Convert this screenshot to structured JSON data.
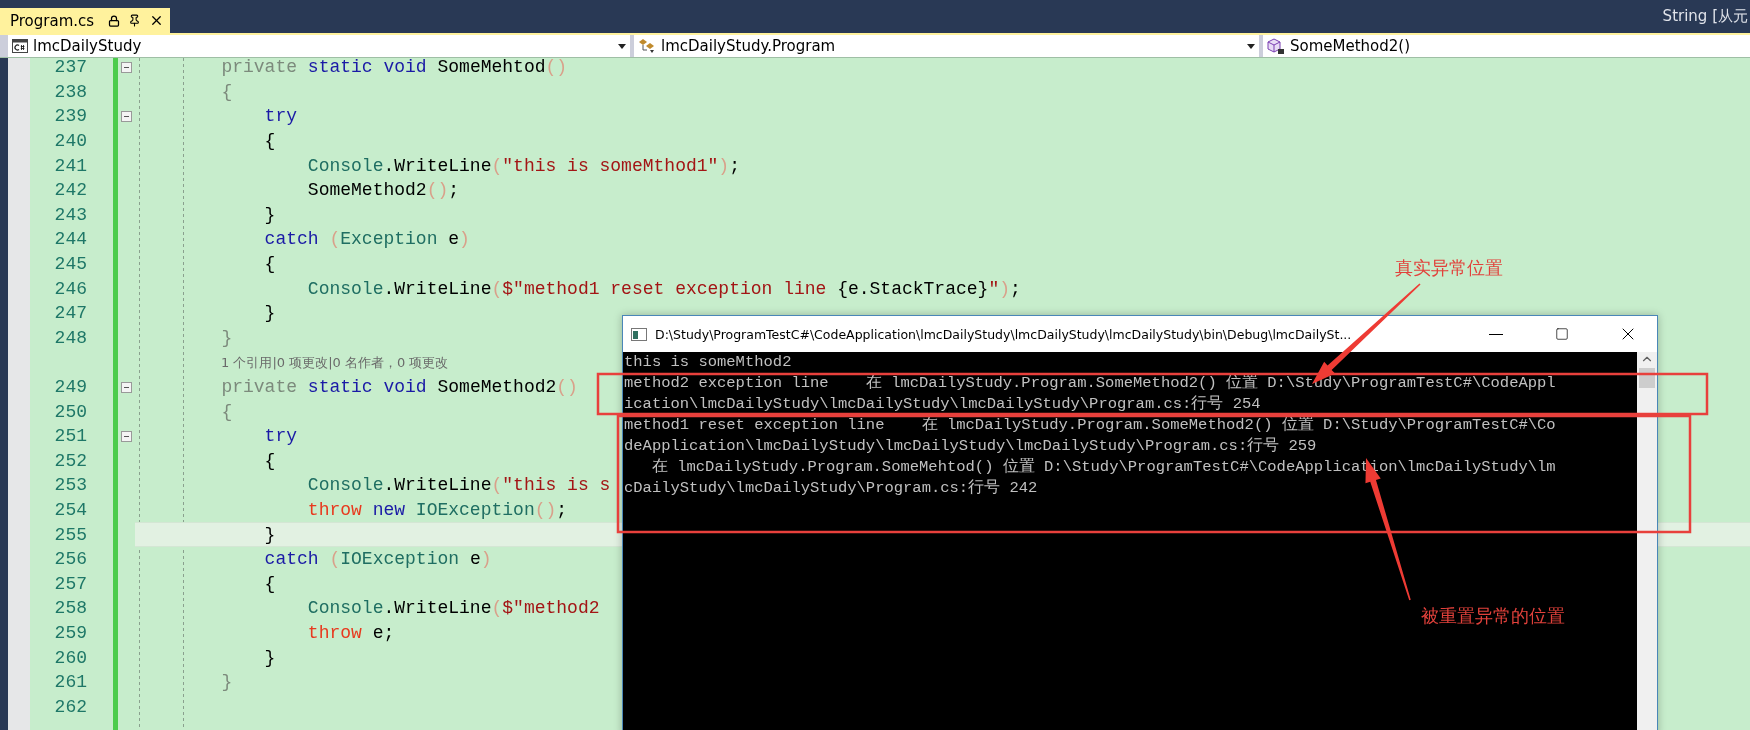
{
  "title_bar": {
    "tab": {
      "label": "Program.cs",
      "selected": true
    },
    "right_text": "String [从元"
  },
  "nav_bar": {
    "dropdowns": [
      {
        "kind": "project",
        "label": "lmcDailyStudy"
      },
      {
        "kind": "class",
        "label": "lmcDailyStudy.Program"
      },
      {
        "kind": "method",
        "label": "SomeMethod2()"
      }
    ]
  },
  "editor": {
    "lines": [
      {
        "kind": "code",
        "number": "237",
        "collapsible": true,
        "current": false,
        "tokens": [
          {
            "text": "        private",
            "kind": "faded"
          },
          {
            "text": " static",
            "kind": "keyword"
          },
          {
            "text": " void",
            "kind": "keyword"
          },
          {
            "text": " SomeMehtod",
            "kind": "plain"
          },
          {
            "text": "()",
            "kind": "paren"
          }
        ]
      },
      {
        "kind": "code",
        "number": "238",
        "collapsible": false,
        "current": false,
        "tokens": [
          {
            "text": "        {",
            "kind": "faded"
          }
        ]
      },
      {
        "kind": "code",
        "number": "239",
        "collapsible": true,
        "current": false,
        "tokens": [
          {
            "text": "            try",
            "kind": "keyword"
          }
        ]
      },
      {
        "kind": "code",
        "number": "240",
        "collapsible": false,
        "current": false,
        "tokens": [
          {
            "text": "            {",
            "kind": "plain"
          }
        ]
      },
      {
        "kind": "code",
        "number": "241",
        "collapsible": false,
        "current": false,
        "tokens": [
          {
            "text": "                Console",
            "kind": "type"
          },
          {
            "text": ".WriteLine",
            "kind": "plain"
          },
          {
            "text": "(",
            "kind": "paren"
          },
          {
            "text": "\"this is someMthod1\"",
            "kind": "string"
          },
          {
            "text": ")",
            "kind": "paren"
          },
          {
            "text": ";",
            "kind": "plain"
          }
        ]
      },
      {
        "kind": "code",
        "number": "242",
        "collapsible": false,
        "current": false,
        "tokens": [
          {
            "text": "                SomeMethod2",
            "kind": "plain"
          },
          {
            "text": "()",
            "kind": "paren"
          },
          {
            "text": ";",
            "kind": "plain"
          }
        ]
      },
      {
        "kind": "code",
        "number": "243",
        "collapsible": false,
        "current": false,
        "tokens": [
          {
            "text": "            }",
            "kind": "plain"
          }
        ]
      },
      {
        "kind": "code",
        "number": "244",
        "collapsible": false,
        "current": false,
        "tokens": [
          {
            "text": "            catch",
            "kind": "keyword"
          },
          {
            "text": " (",
            "kind": "paren"
          },
          {
            "text": "Exception",
            "kind": "type"
          },
          {
            "text": " e",
            "kind": "plain"
          },
          {
            "text": ")",
            "kind": "paren"
          }
        ]
      },
      {
        "kind": "code",
        "number": "245",
        "collapsible": false,
        "current": false,
        "tokens": [
          {
            "text": "            {",
            "kind": "plain"
          }
        ]
      },
      {
        "kind": "code",
        "number": "246",
        "collapsible": false,
        "current": false,
        "tokens": [
          {
            "text": "                Console",
            "kind": "type"
          },
          {
            "text": ".WriteLine",
            "kind": "plain"
          },
          {
            "text": "(",
            "kind": "paren"
          },
          {
            "text": "$\"method1 reset exception line ",
            "kind": "string"
          },
          {
            "text": "{e.StackTrace}",
            "kind": "plain"
          },
          {
            "text": "\"",
            "kind": "string"
          },
          {
            "text": ")",
            "kind": "paren"
          },
          {
            "text": ";",
            "kind": "plain"
          }
        ]
      },
      {
        "kind": "code",
        "number": "247",
        "collapsible": false,
        "current": false,
        "tokens": [
          {
            "text": "            }",
            "kind": "plain"
          }
        ]
      },
      {
        "kind": "code",
        "number": "248",
        "collapsible": false,
        "current": false,
        "tokens": [
          {
            "text": "        }",
            "kind": "faded"
          }
        ]
      },
      {
        "kind": "codelens",
        "text": "1 个引用|0 项更改|0 名作者，0 项更改"
      },
      {
        "kind": "code",
        "number": "249",
        "collapsible": true,
        "current": false,
        "tokens": [
          {
            "text": "        private",
            "kind": "faded"
          },
          {
            "text": " static",
            "kind": "keyword"
          },
          {
            "text": " void",
            "kind": "keyword"
          },
          {
            "text": " SomeMethod2",
            "kind": "plain"
          },
          {
            "text": "()",
            "kind": "paren"
          }
        ]
      },
      {
        "kind": "code",
        "number": "250",
        "collapsible": false,
        "current": false,
        "tokens": [
          {
            "text": "        {",
            "kind": "faded"
          }
        ]
      },
      {
        "kind": "code",
        "number": "251",
        "collapsible": true,
        "current": false,
        "tokens": [
          {
            "text": "            try",
            "kind": "keyword"
          }
        ]
      },
      {
        "kind": "code",
        "number": "252",
        "collapsible": false,
        "current": false,
        "tokens": [
          {
            "text": "            {",
            "kind": "plain"
          }
        ]
      },
      {
        "kind": "code",
        "number": "253",
        "collapsible": false,
        "current": false,
        "tokens": [
          {
            "text": "                Console",
            "kind": "type"
          },
          {
            "text": ".WriteLine",
            "kind": "plain"
          },
          {
            "text": "(",
            "kind": "paren"
          },
          {
            "text": "\"this is s",
            "kind": "string"
          }
        ]
      },
      {
        "kind": "code",
        "number": "254",
        "collapsible": false,
        "current": false,
        "tokens": [
          {
            "text": "                throw",
            "kind": "throw"
          },
          {
            "text": " new",
            "kind": "keyword"
          },
          {
            "text": " IOException",
            "kind": "type"
          },
          {
            "text": "()",
            "kind": "paren"
          },
          {
            "text": ";",
            "kind": "plain"
          }
        ]
      },
      {
        "kind": "code",
        "number": "255",
        "collapsible": false,
        "current": true,
        "tokens": [
          {
            "text": "            }",
            "kind": "plain"
          }
        ]
      },
      {
        "kind": "code",
        "number": "256",
        "collapsible": false,
        "current": false,
        "tokens": [
          {
            "text": "            catch",
            "kind": "keyword"
          },
          {
            "text": " (",
            "kind": "paren"
          },
          {
            "text": "IOException",
            "kind": "type"
          },
          {
            "text": " e",
            "kind": "plain"
          },
          {
            "text": ")",
            "kind": "paren"
          }
        ]
      },
      {
        "kind": "code",
        "number": "257",
        "collapsible": false,
        "current": false,
        "tokens": [
          {
            "text": "            {",
            "kind": "plain"
          }
        ]
      },
      {
        "kind": "code",
        "number": "258",
        "collapsible": false,
        "current": false,
        "tokens": [
          {
            "text": "                Console",
            "kind": "type"
          },
          {
            "text": ".WriteLine",
            "kind": "plain"
          },
          {
            "text": "(",
            "kind": "paren"
          },
          {
            "text": "$\"method2",
            "kind": "string"
          }
        ]
      },
      {
        "kind": "code",
        "number": "259",
        "collapsible": false,
        "current": false,
        "tokens": [
          {
            "text": "                throw",
            "kind": "throw"
          },
          {
            "text": " e;",
            "kind": "plain"
          }
        ]
      },
      {
        "kind": "code",
        "number": "260",
        "collapsible": false,
        "current": false,
        "tokens": [
          {
            "text": "            }",
            "kind": "plain"
          }
        ]
      },
      {
        "kind": "code",
        "number": "261",
        "collapsible": false,
        "current": false,
        "tokens": [
          {
            "text": "        }",
            "kind": "faded"
          }
        ]
      },
      {
        "kind": "code",
        "number": "262",
        "collapsible": false,
        "current": false
      }
    ]
  },
  "console": {
    "title": "D:\\Study\\ProgramTestC#\\CodeApplication\\lmcDailyStudy\\lmcDailyStudy\\lmcDailyStudy\\bin\\Debug\\lmcDailySt...",
    "lines": [
      "this is someMthod2",
      "method2 exception line    在 lmcDailyStudy.Program.SomeMethod2() 位置 D:\\Study\\ProgramTestC#\\CodeAppl",
      "ication\\lmcDailyStudy\\lmcDailyStudy\\lmcDailyStudy\\Program.cs:行号 254",
      "method1 reset exception line    在 lmcDailyStudy.Program.SomeMethod2() 位置 D:\\Study\\ProgramTestC#\\Co",
      "deApplication\\lmcDailyStudy\\lmcDailyStudy\\lmcDailyStudy\\Program.cs:行号 259",
      "   在 lmcDailyStudy.Program.SomeMehtod() 位置 D:\\Study\\ProgramTestC#\\CodeApplication\\lmcDailyStudy\\lm",
      "cDailyStudy\\lmcDailyStudy\\Program.cs:行号 242"
    ]
  },
  "annotations": [
    {
      "text": "真实异常位置"
    },
    {
      "text": "被重置异常的位置"
    }
  ]
}
